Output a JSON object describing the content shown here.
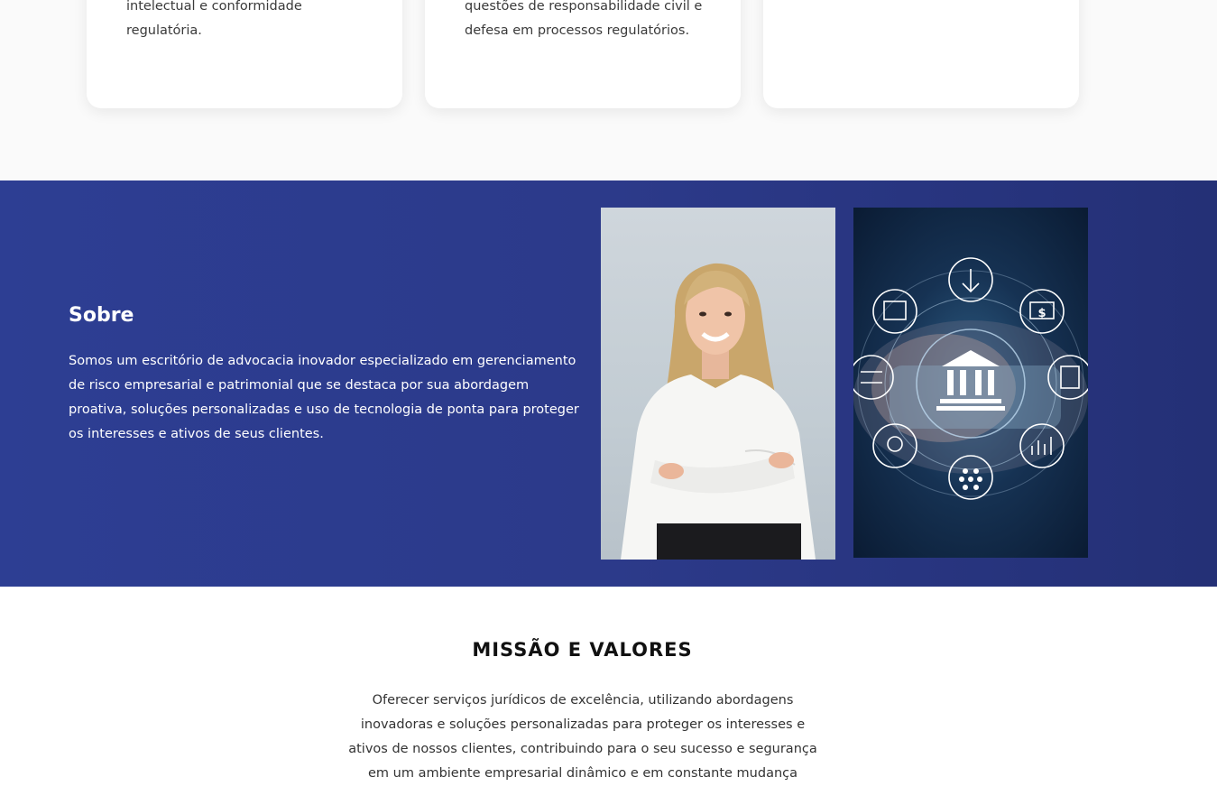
{
  "cards": [
    {
      "text": "intelectual e conformidade regulatória."
    },
    {
      "text": "questões de responsabilidade civil e defesa em processos regulatórios."
    },
    {
      "text": ""
    }
  ],
  "about": {
    "title": "Sobre",
    "text": "Somos um escritório de advocacia inovador especializado em gerenciamento de risco empresarial e patrimonial que se destaca por sua abordagem proativa, soluções personalizadas e uso de tecnologia de ponta para proteger os interesses e ativos de seus clientes."
  },
  "images": {
    "woman": "woman-portrait-photo",
    "tech": "digital-banking-icons-photo"
  },
  "mission": {
    "title": "MISSÃO E VALORES",
    "text": "Oferecer serviços jurídicos de excelência, utilizando abordagens inovadoras e soluções personalizadas para proteger os interesses e ativos de nossos clientes, contribuindo para o seu sucesso e segurança em um ambiente empresarial dinâmico e em constante mudança"
  },
  "colors": {
    "about_bg": "#2d3e93",
    "accent": "#2c3a8a"
  }
}
